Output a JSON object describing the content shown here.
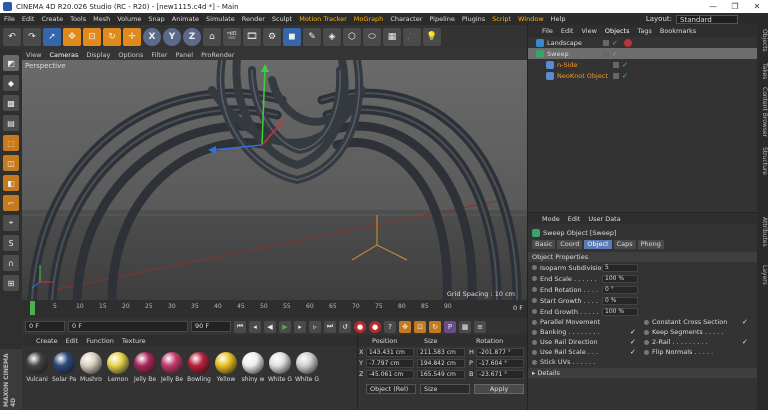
{
  "window": {
    "title": "CINEMA 4D R20.026 Studio (RC - R20) - [new1115.c4d *] - Main",
    "controls": [
      "—",
      "❐",
      "✕"
    ]
  },
  "menubar": {
    "items": [
      "File",
      "Edit",
      "Create",
      "Tools",
      "Mesh",
      "Volume",
      "Snap",
      "Animate",
      "Simulate",
      "Render",
      "Sculpt",
      "Motion Tracker",
      "MoGraph",
      "Character",
      "Pipeline",
      "Plugins",
      "Script",
      "Window",
      "Help"
    ],
    "layout_label": "Layout:",
    "layout_value": "Standard"
  },
  "toolbar": {
    "axis_x": "X",
    "axis_y": "Y",
    "axis_z": "Z"
  },
  "viewport": {
    "menu": [
      "View",
      "Cameras",
      "Display",
      "Options",
      "Filter",
      "Panel",
      "ProRender"
    ],
    "label": "Perspective",
    "grid_spacing": "Grid Spacing : 10 cm"
  },
  "timeline": {
    "ticks": [
      "0",
      "5",
      "10",
      "15",
      "20",
      "25",
      "30",
      "35",
      "40",
      "45",
      "50",
      "55",
      "60",
      "65",
      "70",
      "75",
      "80",
      "85",
      "90"
    ],
    "frame_display": "0 F"
  },
  "playback": {
    "start": "0 F",
    "current": "0 F",
    "end_min": "90 F",
    "end": "90 F"
  },
  "materials": {
    "menu": [
      "Create",
      "Edit",
      "Function",
      "Texture"
    ],
    "items": [
      {
        "name": "Vulcani",
        "color": "#444444"
      },
      {
        "name": "Solar Pa",
        "color": "#2c4a7a"
      },
      {
        "name": "Mushro",
        "color": "#d8d0c0"
      },
      {
        "name": "Lemon",
        "color": "#e6d24a"
      },
      {
        "name": "Jelly Be",
        "color": "#a8285a"
      },
      {
        "name": "Jelly Be",
        "color": "#c43a6c"
      },
      {
        "name": "Bowling",
        "color": "#b8203a"
      },
      {
        "name": "Yellow",
        "color": "#e8c020"
      },
      {
        "name": "shiny w",
        "color": "#eeeeee"
      },
      {
        "name": "White G",
        "color": "#e0e0e0"
      },
      {
        "name": "White G",
        "color": "#d0d0d0"
      }
    ]
  },
  "coordinates": {
    "headers": [
      "Position",
      "Size",
      "Rotation"
    ],
    "rows": [
      {
        "axis": "X",
        "pos": "143.431 cm",
        "size": "211.583 cm",
        "rot_axis": "H",
        "rot": "-201.877 °"
      },
      {
        "axis": "Y",
        "pos": "-7.797 cm",
        "size": "194.842 cm",
        "rot_axis": "P",
        "rot": "-17.604 °"
      },
      {
        "axis": "Z",
        "pos": "-45.061 cm",
        "size": "165.549 cm",
        "rot_axis": "B",
        "rot": "-23.671 °"
      }
    ],
    "mode": "Object (Rel)",
    "size_mode": "Size",
    "apply": "Apply"
  },
  "objects": {
    "menu": [
      "File",
      "Edit",
      "View",
      "Objects",
      "Tags",
      "Bookmarks"
    ],
    "items": [
      {
        "name": "Landscape",
        "indent": 0,
        "selected": false,
        "orange": false
      },
      {
        "name": "Sweep",
        "indent": 0,
        "selected": true,
        "orange": false
      },
      {
        "name": "n-Side",
        "indent": 1,
        "selected": false,
        "orange": true
      },
      {
        "name": "NeoKnot Object",
        "indent": 1,
        "selected": false,
        "orange": true
      }
    ]
  },
  "attributes": {
    "menu": [
      "Mode",
      "Edit",
      "User Data"
    ],
    "object_title": "Sweep Object [Sweep]",
    "tabs": [
      "Basic",
      "Coord",
      "Object",
      "Caps",
      "Phong"
    ],
    "active_tab": "Object",
    "section": "Object Properties",
    "props": [
      {
        "label": "Isoparm Subdivision",
        "value": "5"
      },
      {
        "label": "End Scale . . . . . .",
        "value": "100 %"
      },
      {
        "label": "End Rotation . . . .",
        "value": "0 °"
      },
      {
        "label": "Start Growth . . . .",
        "value": "0 %"
      },
      {
        "label": "End Growth . . . . .",
        "value": "100 %"
      }
    ],
    "bools": [
      {
        "label": "Parallel Movement",
        "checked": ""
      },
      {
        "label": "Constant Cross Section",
        "checked": "✓"
      },
      {
        "label": "Banking . . . . . . . .",
        "checked": "✓"
      },
      {
        "label": "Keep Segments . . . . .",
        "checked": ""
      },
      {
        "label": "Use Rail Direction",
        "checked": "✓"
      },
      {
        "label": "2-Rail . . . . . . . . .",
        "checked": "✓"
      },
      {
        "label": "Use Rail Scale . . .",
        "checked": "✓"
      },
      {
        "label": "Flip Normals . . . . .",
        "checked": ""
      },
      {
        "label": "Stick UVs . . . . . .",
        "checked": ""
      }
    ],
    "details": "▸ Details"
  },
  "righttabs": [
    "Objects",
    "Takes",
    "Content Browser",
    "Structure",
    "Attributes",
    "Layers"
  ],
  "brand": "MAXON CINEMA 4D"
}
